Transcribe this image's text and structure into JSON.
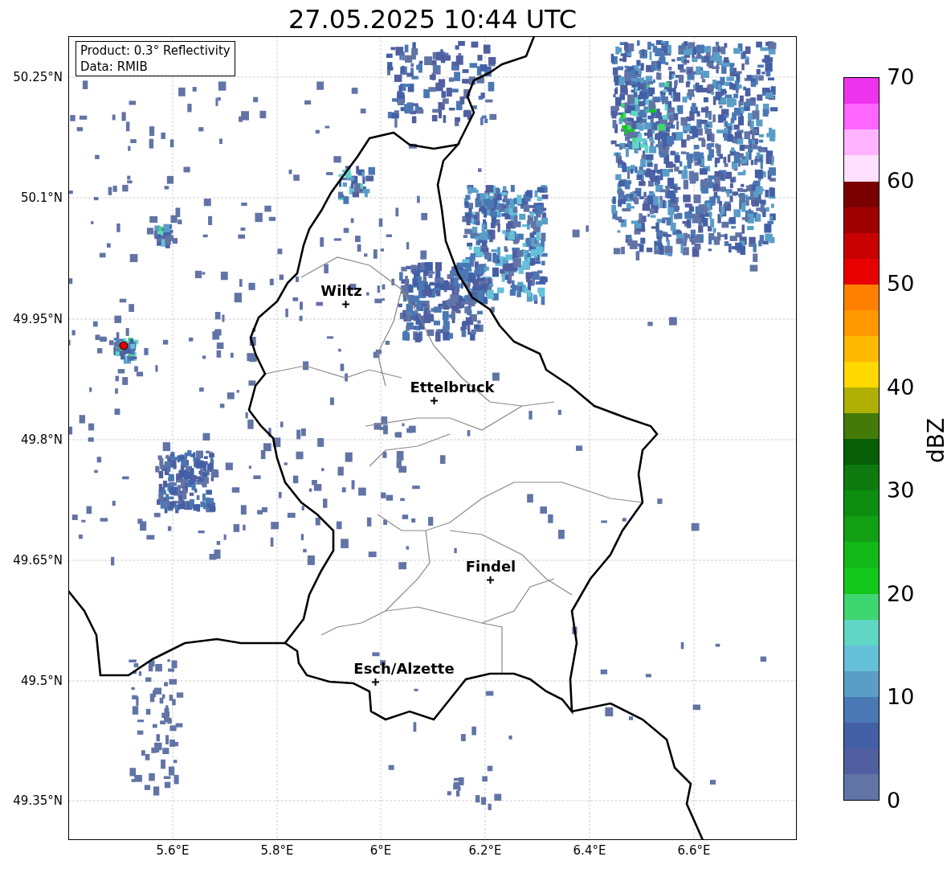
{
  "title": "27.05.2025 10:44 UTC",
  "info_box": [
    "Product: 0.3° Reflectivity",
    "Data: RMIB"
  ],
  "lat_ticks": [
    "50.25°N",
    "50.1°N",
    "49.95°N",
    "49.8°N",
    "49.65°N",
    "49.5°N",
    "49.35°N"
  ],
  "lon_ticks": [
    "5.6°E",
    "5.8°E",
    "6°E",
    "6.2°E",
    "6.4°E",
    "6.6°E"
  ],
  "cities": [
    {
      "name": "Wiltz"
    },
    {
      "name": "Ettelbruck"
    },
    {
      "name": "Findel"
    },
    {
      "name": "Esch/Alzette"
    }
  ],
  "colorbar": {
    "label": "dBZ",
    "ticks": [
      "70",
      "60",
      "50",
      "40",
      "30",
      "20",
      "10",
      "0"
    ],
    "segments": [
      {
        "color": "#6274a6"
      },
      {
        "color": "#515fa0"
      },
      {
        "color": "#4360a6"
      },
      {
        "color": "#4a78b4"
      },
      {
        "color": "#5a9ec8"
      },
      {
        "color": "#65c0da"
      },
      {
        "color": "#60d6c4"
      },
      {
        "color": "#3fd672"
      },
      {
        "color": "#13c81b"
      },
      {
        "color": "#11b817"
      },
      {
        "color": "#11a014"
      },
      {
        "color": "#0e8e10"
      },
      {
        "color": "#0e7a10"
      },
      {
        "color": "#075e07"
      },
      {
        "color": "#437a08"
      },
      {
        "color": "#b0b004"
      },
      {
        "color": "#ffd800"
      },
      {
        "color": "#ffb800"
      },
      {
        "color": "#ff9800"
      },
      {
        "color": "#ff8000"
      },
      {
        "color": "#e80000"
      },
      {
        "color": "#c80000"
      },
      {
        "color": "#a00000"
      },
      {
        "color": "#7a0000"
      },
      {
        "color": "#ffe0ff"
      },
      {
        "color": "#ffb3ff"
      },
      {
        "color": "#ff66ff"
      },
      {
        "color": "#ee33ee"
      }
    ]
  }
}
